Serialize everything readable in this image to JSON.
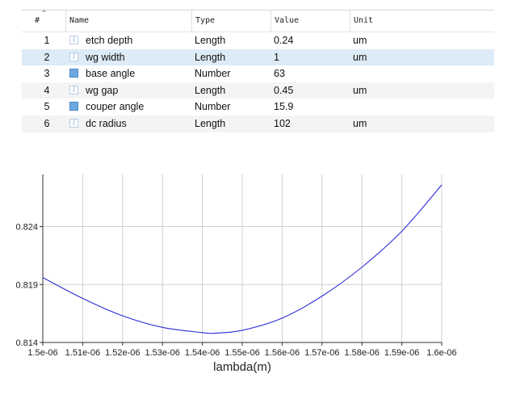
{
  "table": {
    "columns": [
      "#",
      "Name",
      "Type",
      "Value",
      "Unit"
    ],
    "rows": [
      {
        "num": "1",
        "icon": "text-icon",
        "name": "etch depth",
        "type": "Length",
        "value": "0.24",
        "unit": "um"
      },
      {
        "num": "2",
        "icon": "text-icon",
        "name": "wg width",
        "type": "Length",
        "value": "1",
        "unit": "um"
      },
      {
        "num": "3",
        "icon": "number-icon",
        "name": "base angle",
        "type": "Number",
        "value": "63",
        "unit": ""
      },
      {
        "num": "4",
        "icon": "text-icon",
        "name": "wg gap",
        "type": "Length",
        "value": "0.45",
        "unit": "um"
      },
      {
        "num": "5",
        "icon": "number-icon",
        "name": "couper angle",
        "type": "Number",
        "value": "15.9",
        "unit": ""
      },
      {
        "num": "6",
        "icon": "text-icon",
        "name": "dc radius",
        "type": "Length",
        "value": "102",
        "unit": "um"
      }
    ],
    "selected_row": 1,
    "sort_icon": "sort-up-icon"
  },
  "chart_data": {
    "type": "line",
    "title": "",
    "xlabel": "lambda(m)",
    "ylabel": "",
    "xlim": [
      1.5e-06,
      1.6e-06
    ],
    "ylim": [
      0.814,
      0.8285
    ],
    "x_ticks": [
      1.5e-06,
      1.51e-06,
      1.52e-06,
      1.53e-06,
      1.54e-06,
      1.55e-06,
      1.56e-06,
      1.57e-06,
      1.58e-06,
      1.59e-06,
      1.6e-06
    ],
    "x_tick_labels": [
      "1.5e-06",
      "1.51e-06",
      "1.52e-06",
      "1.53e-06",
      "1.54e-06",
      "1.55e-06",
      "1.56e-06",
      "1.57e-06",
      "1.58e-06",
      "1.59e-06",
      "1.6e-06"
    ],
    "y_ticks": [
      0.814,
      0.819,
      0.824
    ],
    "y_tick_labels": [
      "0.814",
      "0.819",
      "0.824"
    ],
    "grid": true,
    "line_color": "#2b2bd6",
    "x": [
      1.5e-06,
      1.51e-06,
      1.52e-06,
      1.53e-06,
      1.54e-06,
      1.543e-06,
      1.55e-06,
      1.56e-06,
      1.57e-06,
      1.58e-06,
      1.59e-06,
      1.6e-06
    ],
    "y": [
      0.8196,
      0.8178,
      0.8163,
      0.8153,
      0.81485,
      0.8148,
      0.81505,
      0.8161,
      0.818,
      0.8205,
      0.8236,
      0.8276
    ]
  }
}
